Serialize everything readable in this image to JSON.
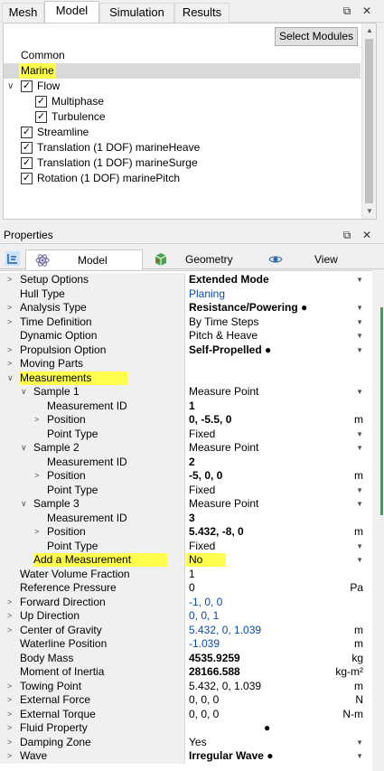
{
  "top_tabs": [
    {
      "label": "Mesh"
    },
    {
      "label": "Model"
    },
    {
      "label": "Simulation"
    },
    {
      "label": "Results"
    }
  ],
  "top_controls": {
    "undock": "⧉",
    "close": "✕"
  },
  "modules": {
    "select_button": "Select Modules",
    "items": [
      {
        "label": "Common"
      },
      {
        "label": "Marine"
      },
      {
        "label": "Flow"
      },
      {
        "label": "Multiphase"
      },
      {
        "label": "Turbulence"
      },
      {
        "label": "Streamline"
      },
      {
        "label": "Translation (1 DOF) marineHeave"
      },
      {
        "label": "Translation (1 DOF) marineSurge"
      },
      {
        "label": "Rotation (1 DOF) marinePitch"
      }
    ]
  },
  "properties": {
    "title": "Properties",
    "tabs": [
      {
        "label": "Model"
      },
      {
        "label": "Geometry"
      },
      {
        "label": "View"
      }
    ],
    "rows": [
      {
        "name": "Setup Options",
        "value": "Extended Mode",
        "unit": ""
      },
      {
        "name": "Hull Type",
        "value": "Planing",
        "unit": ""
      },
      {
        "name": "Analysis Type",
        "value": "Resistance/Powering ●",
        "unit": ""
      },
      {
        "name": "Time Definition",
        "value": "By Time Steps",
        "unit": ""
      },
      {
        "name": "Dynamic Option",
        "value": "Pitch & Heave",
        "unit": ""
      },
      {
        "name": "Propulsion Option",
        "value": "Self-Propelled ●",
        "unit": ""
      },
      {
        "name": "Moving Parts",
        "value": "",
        "unit": ""
      },
      {
        "name": "Measurements",
        "value": "",
        "unit": ""
      },
      {
        "name": "Sample 1",
        "value": "Measure Point",
        "unit": ""
      },
      {
        "name": "Measurement ID",
        "value": "1",
        "unit": ""
      },
      {
        "name": "Position",
        "value": "0, -5.5, 0",
        "unit": "m"
      },
      {
        "name": "Point Type",
        "value": "Fixed",
        "unit": ""
      },
      {
        "name": "Sample 2",
        "value": "Measure Point",
        "unit": ""
      },
      {
        "name": "Measurement ID",
        "value": "2",
        "unit": ""
      },
      {
        "name": "Position",
        "value": "-5, 0, 0",
        "unit": "m"
      },
      {
        "name": "Point Type",
        "value": "Fixed",
        "unit": ""
      },
      {
        "name": "Sample 3",
        "value": "Measure Point",
        "unit": ""
      },
      {
        "name": "Measurement ID",
        "value": "3",
        "unit": ""
      },
      {
        "name": "Position",
        "value": "5.432, -8, 0",
        "unit": "m"
      },
      {
        "name": "Point Type",
        "value": "Fixed",
        "unit": ""
      },
      {
        "name": "Add a Measurement",
        "value": "No",
        "unit": ""
      },
      {
        "name": "Water Volume Fraction",
        "value": "1",
        "unit": ""
      },
      {
        "name": "Reference Pressure",
        "value": "0",
        "unit": "Pa"
      },
      {
        "name": "Forward Direction",
        "value": "-1, 0, 0",
        "unit": ""
      },
      {
        "name": "Up Direction",
        "value": "0, 0, 1",
        "unit": ""
      },
      {
        "name": "Center of Gravity",
        "value": "5.432, 0, 1.039",
        "unit": "m"
      },
      {
        "name": "Waterline Position",
        "value": "-1.039",
        "unit": "m"
      },
      {
        "name": "Body Mass",
        "value": "4535.9259",
        "unit": "kg"
      },
      {
        "name": "Moment of Inertia",
        "value": "28166.588",
        "unit": "kg-m²"
      },
      {
        "name": "Towing Point",
        "value": "5.432, 0, 1.039",
        "unit": "m"
      },
      {
        "name": "External Force",
        "value": "0, 0, 0",
        "unit": "N"
      },
      {
        "name": "External Torque",
        "value": "0, 0, 0",
        "unit": "N-m"
      },
      {
        "name": "Fluid Property",
        "value": "●",
        "unit": ""
      },
      {
        "name": "Damping Zone",
        "value": "Yes",
        "unit": ""
      },
      {
        "name": "Wave",
        "value": "Irregular Wave ●",
        "unit": ""
      }
    ]
  },
  "colors": {
    "highlight": "#ffff4d",
    "link_blue": "#0b4aa8",
    "selection": "#d9d9d9"
  }
}
